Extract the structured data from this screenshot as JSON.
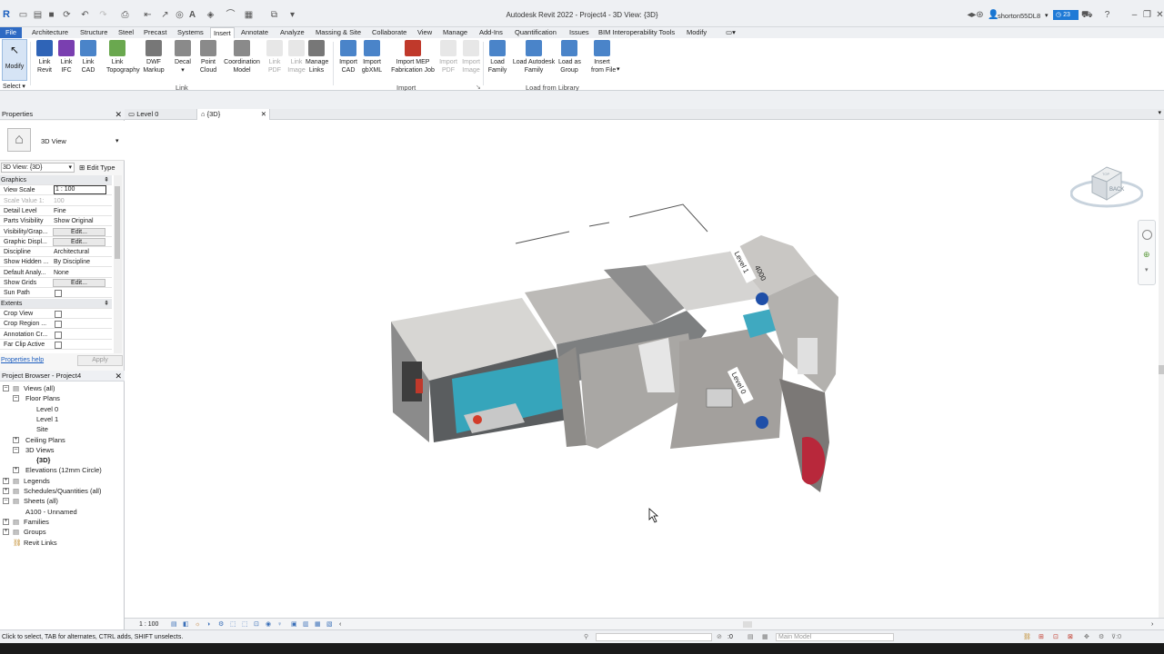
{
  "window": {
    "title": "Autodesk Revit 2022 - Project4 - 3D View: {3D}",
    "user": "shorton55DL8",
    "notif_count": "23"
  },
  "tabs": [
    "File",
    "Architecture",
    "Structure",
    "Steel",
    "Precast",
    "Systems",
    "Insert",
    "Annotate",
    "Analyze",
    "Massing & Site",
    "Collaborate",
    "View",
    "Manage",
    "Add-Ins",
    "Quantification",
    "Issues",
    "BIM Interoperability Tools",
    "Modify"
  ],
  "ribbon": {
    "modify": "Modify",
    "select": "Select ▾",
    "buttons": [
      {
        "label": "Link\nRevit",
        "color": "#2f64b7"
      },
      {
        "label": "Link\nIFC",
        "color": "#7a3fb0"
      },
      {
        "label": "Link\nCAD",
        "color": "#4a84c9"
      },
      {
        "label": "Link\nTopography",
        "color": "#6aa84f"
      },
      {
        "label": "DWF\nMarkup",
        "color": "#777777"
      },
      {
        "label": "Decal\n▾",
        "color": "#8a8a8a"
      },
      {
        "label": "Point\nCloud",
        "color": "#8a8a8a"
      },
      {
        "label": "Coordination\nModel",
        "color": "#8a8a8a"
      },
      {
        "label": "Link\nPDF",
        "color": "#bbbbbb"
      },
      {
        "label": "Link\nImage",
        "color": "#bbbbbb"
      },
      {
        "label": "Manage\nLinks",
        "color": "#777777"
      },
      {
        "label": "Import\nCAD",
        "color": "#4a84c9"
      },
      {
        "label": "Import\ngbXML",
        "color": "#4a84c9"
      },
      {
        "label": "Import MEP\nFabrication Job",
        "color": "#c0392b"
      },
      {
        "label": "Import\nPDF",
        "color": "#bbbbbb"
      },
      {
        "label": "Import\nImage",
        "color": "#bbbbbb"
      },
      {
        "label": "Load\nFamily",
        "color": "#4a84c9"
      },
      {
        "label": "Load Autodesk\nFamily",
        "color": "#4a84c9"
      },
      {
        "label": "Load as\nGroup",
        "color": "#4a84c9"
      },
      {
        "label": "Insert\nfrom File",
        "color": "#4a84c9"
      }
    ],
    "panels": [
      "Link",
      "Import",
      "Load from Library"
    ]
  },
  "properties": {
    "header": "Properties",
    "type": "3D View",
    "selector": "3D View: {3D}",
    "edit_type": "Edit Type",
    "rows": [
      {
        "k": "Graphics",
        "group": true
      },
      {
        "k": "View Scale",
        "v": "1 : 100"
      },
      {
        "k": "Scale Value    1:",
        "v": "100"
      },
      {
        "k": "Detail Level",
        "v": "Fine"
      },
      {
        "k": "Parts Visibility",
        "v": "Show Original"
      },
      {
        "k": "Visibility/Grap...",
        "btn": "Edit..."
      },
      {
        "k": "Graphic Displ...",
        "btn": "Edit..."
      },
      {
        "k": "Discipline",
        "v": "Architectural"
      },
      {
        "k": "Show Hidden ...",
        "v": "By Discipline"
      },
      {
        "k": "Default Analy...",
        "v": "None"
      },
      {
        "k": "Show Grids",
        "btn": "Edit..."
      },
      {
        "k": "Sun Path",
        "cb": true
      },
      {
        "k": "Extents",
        "group": true
      },
      {
        "k": "Crop View",
        "cb": true
      },
      {
        "k": "Crop Region ...",
        "cb": true
      },
      {
        "k": "Annotation Cr...",
        "cb": true
      },
      {
        "k": "Far Clip Active",
        "cb": true
      }
    ],
    "help": "Properties help",
    "apply": "Apply"
  },
  "browser": {
    "header": "Project Browser - Project4",
    "items": [
      {
        "label": "Views (all)",
        "lvl": 0,
        "box": "⊟"
      },
      {
        "label": "Floor Plans",
        "lvl": 1,
        "box": "⊟"
      },
      {
        "label": "Level 0",
        "lvl": 2
      },
      {
        "label": "Level 1",
        "lvl": 2
      },
      {
        "label": "Site",
        "lvl": 2
      },
      {
        "label": "Ceiling Plans",
        "lvl": 1,
        "box": "⊞"
      },
      {
        "label": "3D Views",
        "lvl": 1,
        "box": "⊟"
      },
      {
        "label": "{3D}",
        "lvl": 2,
        "sel": true
      },
      {
        "label": "Elevations (12mm Circle)",
        "lvl": 1,
        "box": "⊞"
      },
      {
        "label": "Legends",
        "lvl": 0,
        "box": "⊞"
      },
      {
        "label": "Schedules/Quantities (all)",
        "lvl": 0,
        "box": "⊞"
      },
      {
        "label": "Sheets (all)",
        "lvl": 0,
        "box": "⊟"
      },
      {
        "label": "A100 - Unnamed",
        "lvl": 1
      },
      {
        "label": "Families",
        "lvl": 0,
        "box": "⊞"
      },
      {
        "label": "Groups",
        "lvl": 0,
        "box": "⊞"
      },
      {
        "label": "Revit Links",
        "lvl": 0
      }
    ]
  },
  "viewtabs": [
    {
      "label": "Level 0"
    },
    {
      "label": "{3D}",
      "active": true
    }
  ],
  "model": {
    "level1": "Level 1",
    "level_val": "4000",
    "level0": "Level 0"
  },
  "viewcube": {
    "face": "BACK",
    "top": "TOP"
  },
  "viewbar": {
    "scale": "1 : 100"
  },
  "status": {
    "hint": "Click to select, TAB for alternates, CTRL adds, SHIFT unselects.",
    "model": "Main Model",
    "zero": ":0"
  }
}
